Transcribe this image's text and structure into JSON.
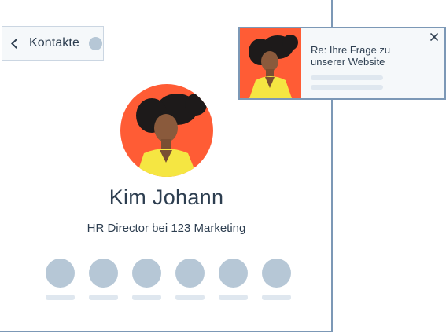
{
  "back_button": {
    "label": "Kontakte"
  },
  "contact": {
    "name": "Kim Johann",
    "title": "HR Director bei 123 Marketing",
    "avatar_icon": "person-photo-icon"
  },
  "actions": [
    {
      "icon": "action-icon"
    },
    {
      "icon": "action-icon"
    },
    {
      "icon": "action-icon"
    },
    {
      "icon": "action-icon"
    },
    {
      "icon": "action-icon"
    },
    {
      "icon": "action-icon"
    }
  ],
  "notification": {
    "subject": "Re: Ihre Frage zu unserer Website",
    "close_icon": "close-icon"
  },
  "colors": {
    "border": "#7c98b6",
    "placeholder": "#b6c7d6",
    "placeholder_light": "#dfe7ef",
    "text": "#2d3e50",
    "photo_background": "#ff5c35",
    "jacket": "#f5e642"
  }
}
